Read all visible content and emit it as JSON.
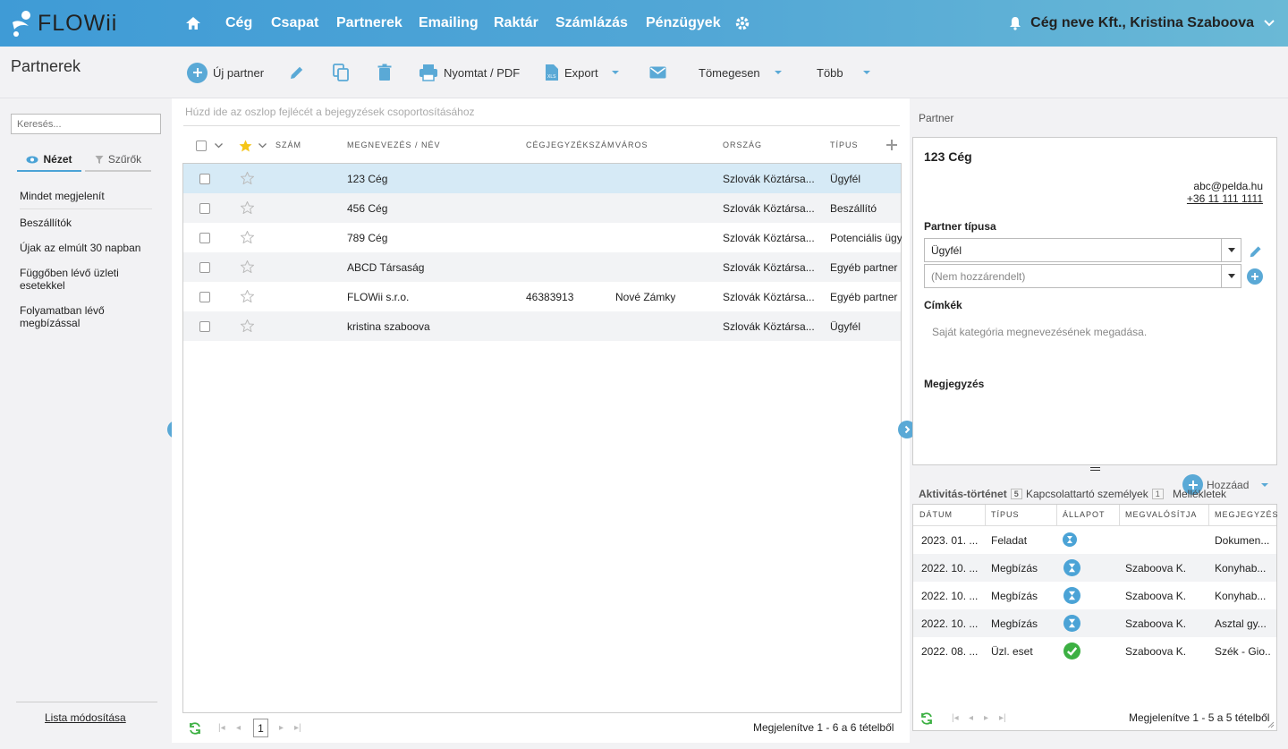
{
  "app": {
    "logo_text": "FLOWii"
  },
  "nav": {
    "items": [
      "Cég",
      "Csapat",
      "Partnerek",
      "Emailing",
      "Raktár",
      "Számlázás",
      "Pénzügyek"
    ],
    "user_label": "Cég neve Kft., Kristina Szaboova"
  },
  "page": {
    "title": "Partnerek"
  },
  "toolbar": {
    "new_partner": "Új partner",
    "print": "Nyomtat / PDF",
    "export": "Export",
    "bulk": "Tömegesen",
    "more": "Több"
  },
  "sidebar": {
    "search_placeholder": "Keresés...",
    "tab_view": "Nézet",
    "tab_filters": "Szűrők",
    "items": [
      "Mindet megjelenít",
      "Beszállítók",
      "Újak az elmúlt 30 napban",
      "Függőben lévő üzleti esetekkel",
      "Folyamatban lévő megbízással"
    ],
    "edit_list": "Lista módosítása"
  },
  "grid": {
    "group_hint": "Húzd ide az oszlop fejlécét a bejegyzések csoportosításához",
    "columns": [
      "SZÁM",
      "MEGNEVEZÉS / NÉV",
      "CÉGJEGYZÉKSZÁM",
      "VÁROS",
      "ORSZÁG",
      "TÍPUS"
    ],
    "rows": [
      {
        "name": "123 Cég",
        "reg": "",
        "city": "",
        "country": "Szlovák Köztársa...",
        "type": "Ügyfél",
        "selected": true
      },
      {
        "name": "456 Cég",
        "reg": "",
        "city": "",
        "country": "Szlovák Köztársa...",
        "type": "Beszállító"
      },
      {
        "name": "789 Cég",
        "reg": "",
        "city": "",
        "country": "Szlovák Köztársa...",
        "type": "Potenciális ügyf"
      },
      {
        "name": "ABCD Társaság",
        "reg": "",
        "city": "",
        "country": "Szlovák Köztársa...",
        "type": "Egyéb partner"
      },
      {
        "name": "FLOWii s.r.o.",
        "reg": "46383913",
        "city": "Nové Zámky",
        "country": "Szlovák Köztársa...",
        "type": "Egyéb partner"
      },
      {
        "name": "kristina szaboova",
        "reg": "",
        "city": "",
        "country": "Szlovák Köztársa...",
        "type": "Ügyfél"
      }
    ],
    "page": "1",
    "summary": "Megjelenítve 1 - 6 a 6 tételből"
  },
  "detail": {
    "section_label": "Partner",
    "name": "123 Cég",
    "email": "abc@pelda.hu",
    "phone": "+36 11 111 1111",
    "type_label": "Partner típusa",
    "type_value": "Ügyfél",
    "type_placeholder": "(Nem hozzárendelt)",
    "tags_label": "Címkék",
    "tags_placeholder": "Saját kategória megnevezésének megadása.",
    "note_label": "Megjegyzés"
  },
  "activity": {
    "add_label": "Hozzáad",
    "tabs": [
      {
        "label": "Aktivitás-történet",
        "count": "5"
      },
      {
        "label": "Kapcsolattartó személyek",
        "count": "1"
      },
      {
        "label": "Mellékletek",
        "count": ""
      }
    ],
    "columns": [
      "DÁTUM",
      "TÍPUS",
      "ÁLLAPOT",
      "MEGVALÓSÍTJA",
      "MEGJEGYZÉS"
    ],
    "rows": [
      {
        "date": "2023. 01. ...",
        "type": "Feladat",
        "status": "pending",
        "owner": "",
        "note": "Dokumen..."
      },
      {
        "date": "2022. 10. ...",
        "type": "Megbízás",
        "status": "pending",
        "owner": "Szaboova K.",
        "note": "Konyhab..."
      },
      {
        "date": "2022. 10. ...",
        "type": "Megbízás",
        "status": "pending",
        "owner": "Szaboova K.",
        "note": "Konyhab..."
      },
      {
        "date": "2022. 10. ...",
        "type": "Megbízás",
        "status": "pending",
        "owner": "Szaboova K.",
        "note": "Asztal gy..."
      },
      {
        "date": "2022. 08. ...",
        "type": "Üzl. eset",
        "status": "done",
        "owner": "Szaboova K.",
        "note": "Szék - Gio..."
      }
    ],
    "summary": "Megjelenítve 1 - 5 a 5 tételből"
  },
  "colors": {
    "accent": "#4ba3d6",
    "selected_row": "#d6eaf6",
    "alt_row": "#f2f3f5",
    "done": "#3cb043",
    "star": "#f5c518"
  }
}
